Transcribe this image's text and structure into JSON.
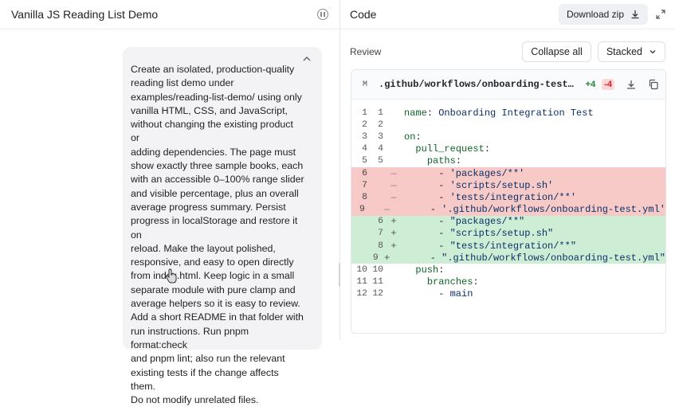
{
  "left_panel": {
    "title": "Vanilla JS Reading List Demo",
    "prompt_lines": [
      "Create an isolated, production-quality",
      "reading list demo under",
      "examples/reading-list-demo/ using only",
      "vanilla HTML, CSS, and JavaScript,",
      "without changing the existing product or",
      "adding dependencies. The page must",
      "show exactly three sample books, each",
      "with an accessible 0–100% range slider",
      "and visible percentage, plus an overall",
      "average progress summary. Persist",
      "progress in localStorage and restore it on",
      "reload. Make the layout polished,",
      "responsive, and easy to open directly",
      "from index.html. Keep logic in a small",
      "separate module with pure clamp and",
      "average helpers so it is easy to review.",
      "Add a short README in that folder with",
      "run instructions. Run pnpm format:check",
      "and pnpm lint; also run the relevant",
      "existing tests if the change affects them.",
      "Do not modify unrelated files."
    ]
  },
  "right_panel": {
    "title": "Code",
    "download_label": "Download zip",
    "review_label": "Review",
    "collapse_label": "Collapse all",
    "view_mode": "Stacked",
    "file": {
      "status": "M",
      "name": ".github/workflows/onboarding-test…",
      "additions": "+4",
      "deletions": "-4"
    },
    "diff_lines": [
      {
        "old": "1",
        "new": "1",
        "type": "ctx",
        "mark": "",
        "code": "name: Onboarding Integration Test"
      },
      {
        "old": "2",
        "new": "2",
        "type": "ctx",
        "mark": "",
        "code": ""
      },
      {
        "old": "3",
        "new": "3",
        "type": "ctx",
        "mark": "",
        "code": "on:"
      },
      {
        "old": "4",
        "new": "4",
        "type": "ctx",
        "mark": "",
        "code": "  pull_request:"
      },
      {
        "old": "5",
        "new": "5",
        "type": "ctx",
        "mark": "",
        "code": "    paths:"
      },
      {
        "old": "6",
        "new": "",
        "type": "del",
        "mark": "—",
        "code": "      - 'packages/**'"
      },
      {
        "old": "7",
        "new": "",
        "type": "del",
        "mark": "—",
        "code": "      - 'scripts/setup.sh'"
      },
      {
        "old": "8",
        "new": "",
        "type": "del",
        "mark": "—",
        "code": "      - 'tests/integration/**'"
      },
      {
        "old": "9",
        "new": "",
        "type": "del",
        "mark": "—",
        "code": "      - '.github/workflows/onboarding-test.yml'"
      },
      {
        "old": "",
        "new": "6",
        "type": "add",
        "mark": "+",
        "code": "      - \"packages/**\""
      },
      {
        "old": "",
        "new": "7",
        "type": "add",
        "mark": "+",
        "code": "      - \"scripts/setup.sh\""
      },
      {
        "old": "",
        "new": "8",
        "type": "add",
        "mark": "+",
        "code": "      - \"tests/integration/**\""
      },
      {
        "old": "",
        "new": "9",
        "type": "add",
        "mark": "+",
        "code": "      - \".github/workflows/onboarding-test.yml\""
      },
      {
        "old": "10",
        "new": "10",
        "type": "ctx",
        "mark": "",
        "code": "  push:"
      },
      {
        "old": "11",
        "new": "11",
        "type": "ctx",
        "mark": "",
        "code": "    branches:"
      },
      {
        "old": "12",
        "new": "12",
        "type": "ctx",
        "mark": "",
        "code": "      - main"
      }
    ]
  }
}
